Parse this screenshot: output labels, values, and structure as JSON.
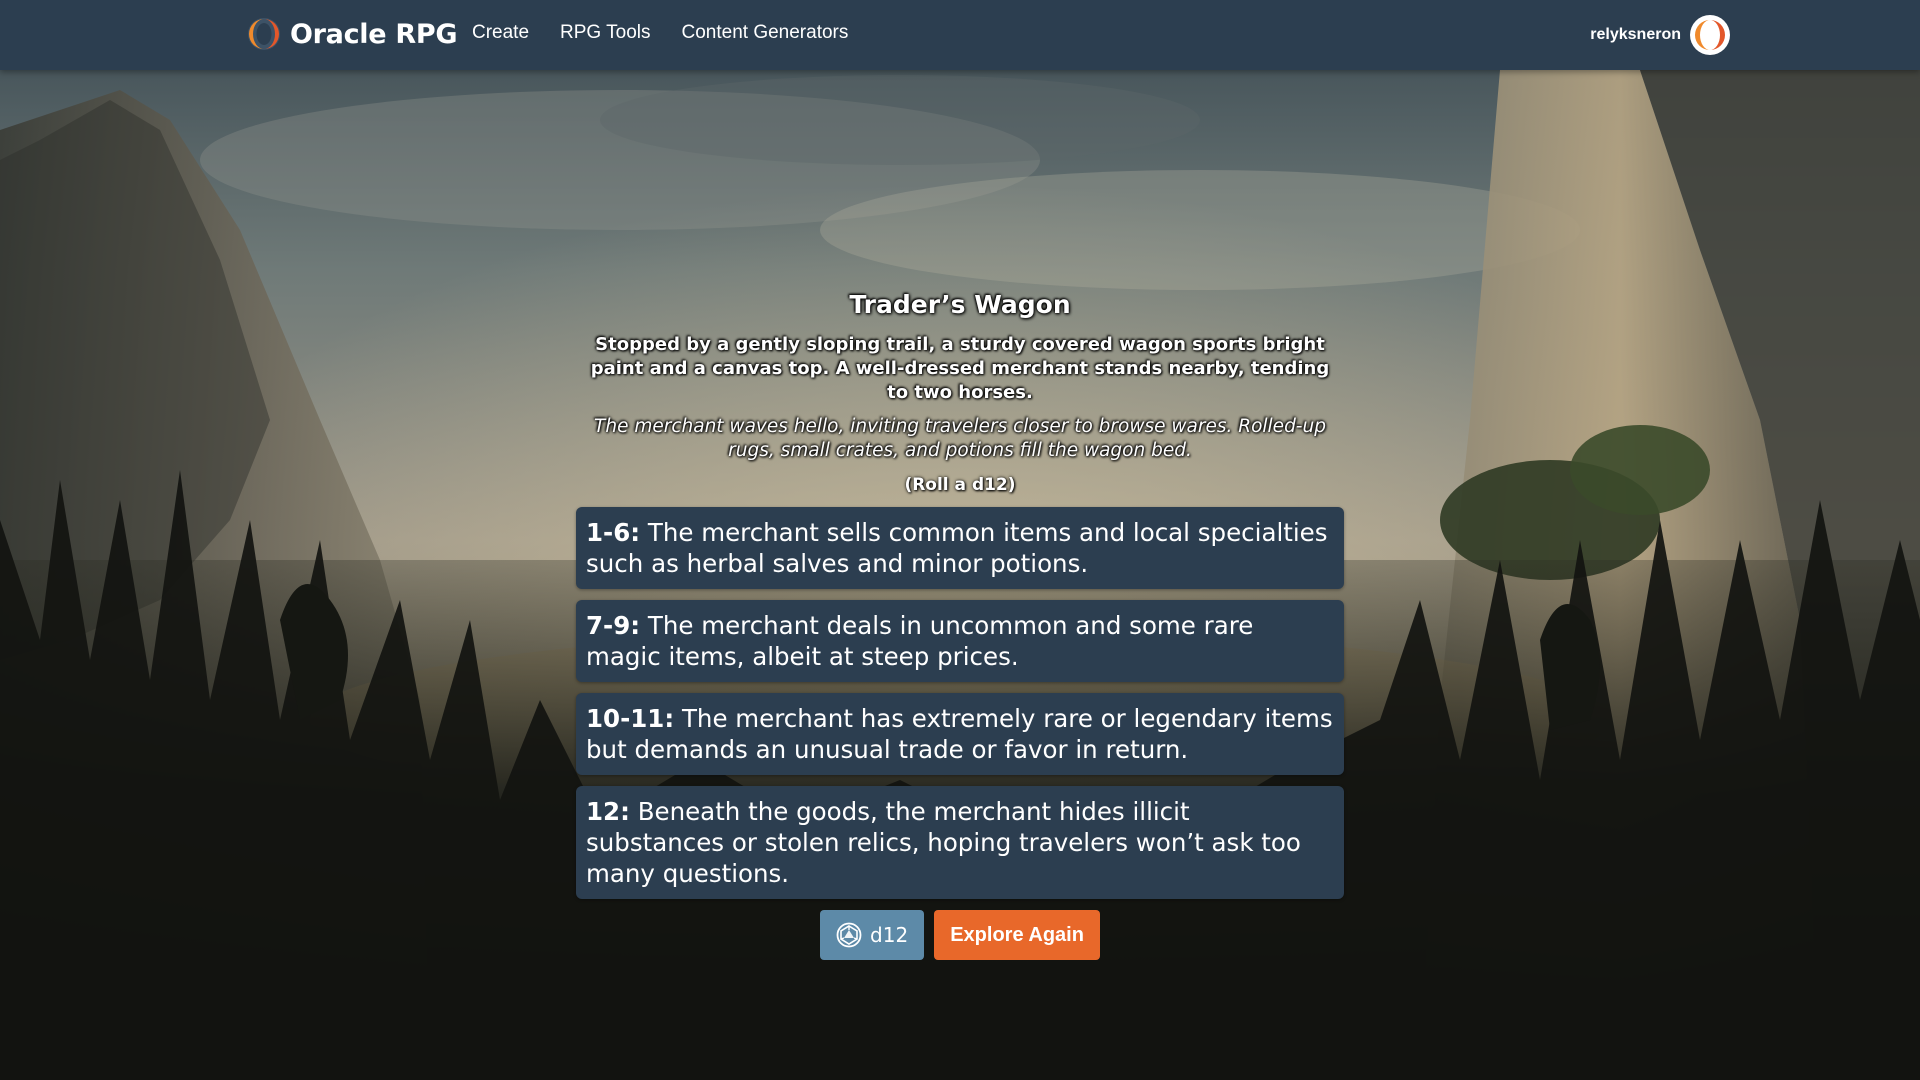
{
  "header": {
    "brand": "Oracle RPG",
    "nav": [
      {
        "label": "Create"
      },
      {
        "label": "RPG Tools"
      },
      {
        "label": "Content Generators"
      }
    ],
    "username": "relyksneron"
  },
  "encounter": {
    "title": "Trader’s Wagon",
    "description": "Stopped by a gently sloping trail, a sturdy covered wagon sports bright paint and a canvas top. A well-dressed merchant stands nearby, tending to two horses.",
    "flavor": "The merchant waves hello, inviting travelers closer to browse wares. Rolled-up rugs, small crates, and potions fill the wagon bed.",
    "roll_hint": "(Roll a d12)",
    "outcomes": [
      {
        "range": "1-6:",
        "text": "The merchant sells common items and local specialties such as herbal salves and minor potions."
      },
      {
        "range": "7-9:",
        "text": "The merchant deals in uncommon and some rare magic items, albeit at steep prices."
      },
      {
        "range": "10-11:",
        "text": "The merchant has extremely rare or legendary items but demands an unusual trade or favor in return."
      },
      {
        "range": "12:",
        "text": "Beneath the goods, the merchant hides illicit substances or stolen relics, hoping travelers won’t ask too many questions."
      }
    ]
  },
  "actions": {
    "dice_label": "d12",
    "dice_icon": "d20-die-icon",
    "explore_label": "Explore Again"
  },
  "colors": {
    "header_bg": "#2c3e50",
    "card_bg": "#2c3e50",
    "dice_button": "#5d8aa8",
    "explore_button": "#e8682a"
  }
}
